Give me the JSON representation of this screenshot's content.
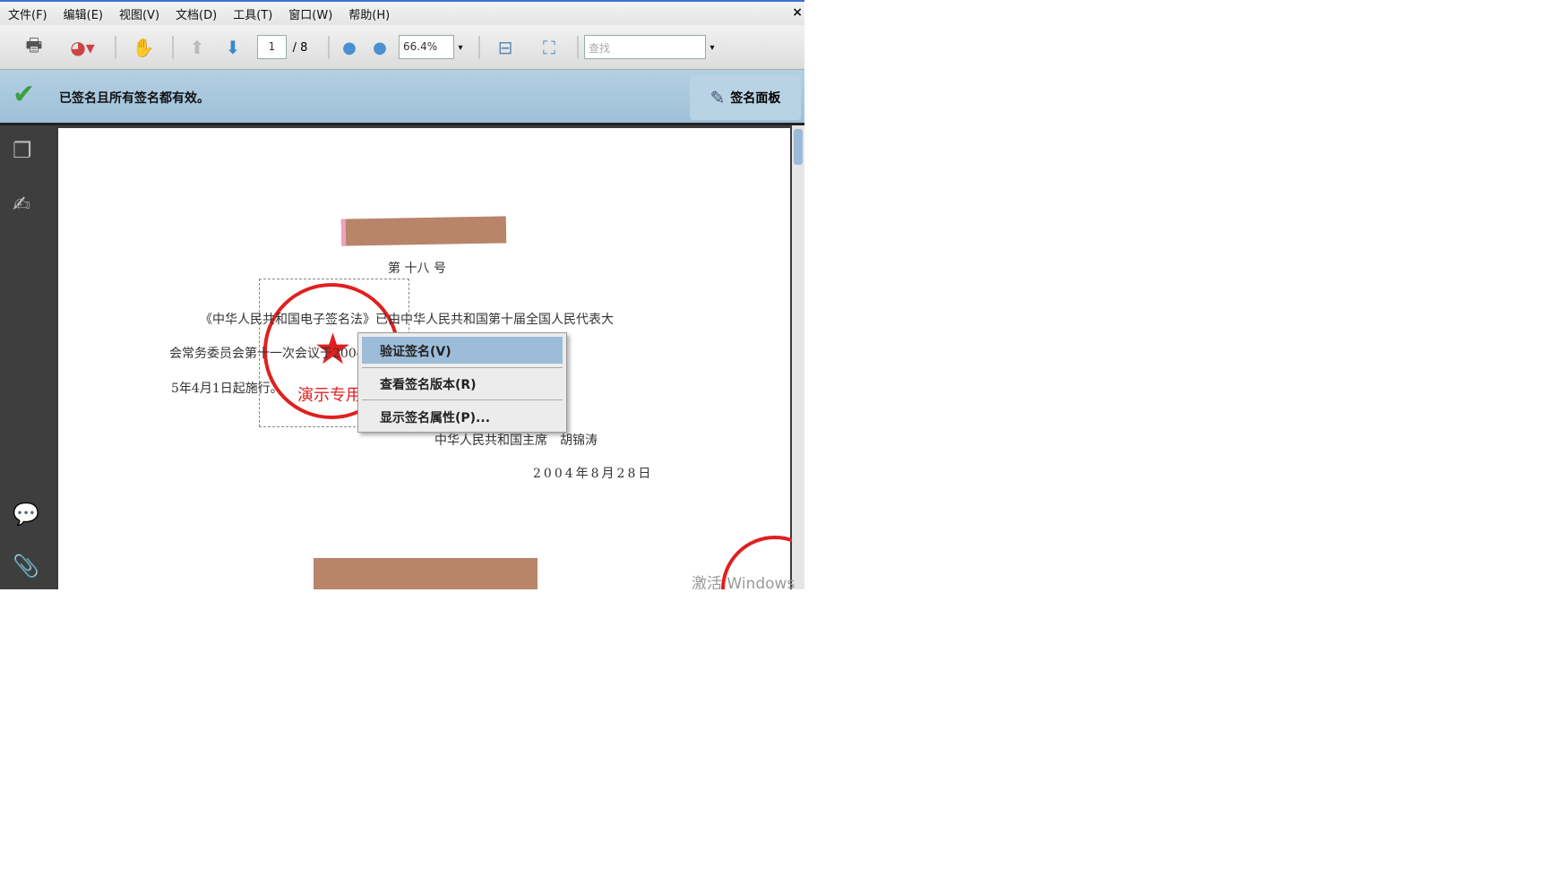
{
  "menubar": {
    "items": [
      "文件(F)",
      "编辑(E)",
      "视图(V)",
      "文档(D)",
      "工具(T)",
      "窗口(W)",
      "帮助(H)"
    ],
    "close": "×"
  },
  "toolbar": {
    "page_current": "1",
    "page_total": "/ 8",
    "zoom": "66.4%",
    "search_placeholder": "查找"
  },
  "signature_bar": {
    "message": "已签名且所有签名都有效。",
    "panel_button": "签名面板"
  },
  "document": {
    "number": "第 十八 号",
    "line1": "《中华人民共和国电子签名法》已由中华人民共和国第十届全国人民代表大",
    "line2": "会常务委员会第十一次会议于2004年8月28日通过，现予公布，自200",
    "line3": "5年4月1日起施行。",
    "signer": "中华人民共和国主席　胡锦涛",
    "date": "2004年8月28日",
    "stamp_text": "演示专用"
  },
  "context_menu": {
    "items": [
      "验证签名(V)",
      "查看签名版本(R)",
      "显示签名属性(P)..."
    ]
  },
  "watermark": "激活 Windows",
  "colors": {
    "sig_bar": "#a8c8dc",
    "menu_selected": "#9cbcd8",
    "stamp": "#e02020"
  }
}
